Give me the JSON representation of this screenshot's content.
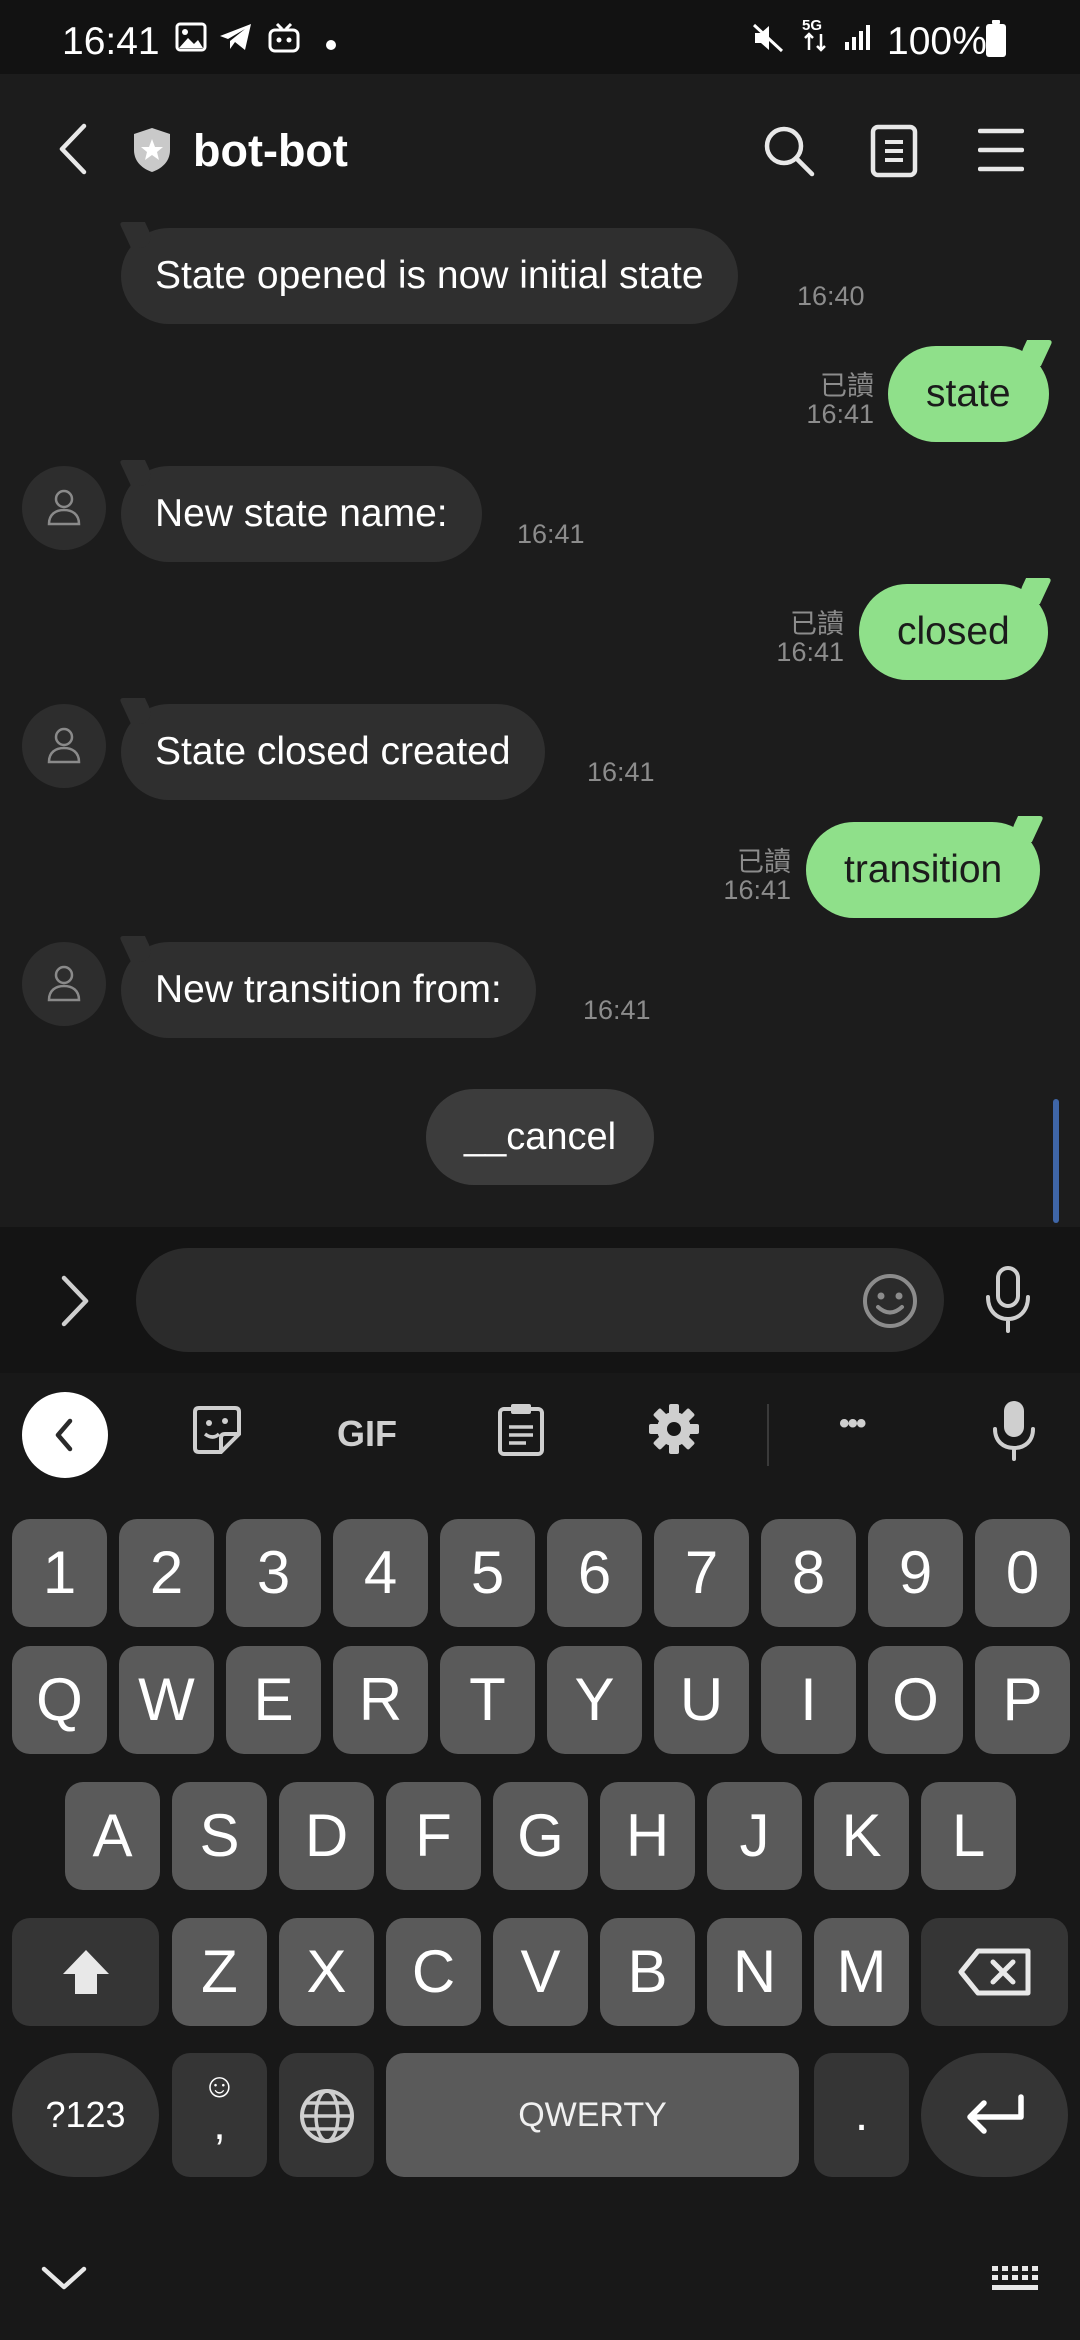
{
  "status_bar": {
    "time": "16:41",
    "battery": "100%",
    "network": "5G",
    "left_icons": [
      "image-icon",
      "telegram-icon",
      "bilibili-icon",
      "dot-icon"
    ],
    "right_icons": [
      "mute-icon",
      "5g-data-icon",
      "signal-icon",
      "battery-icon"
    ]
  },
  "header": {
    "title": "bot-bot",
    "icons": [
      "back-icon",
      "shield-star-icon",
      "search-icon",
      "notes-icon",
      "menu-icon"
    ]
  },
  "messages": [
    {
      "side": "in",
      "text": "State opened is now initial state",
      "time": "16:40",
      "avatar": false
    },
    {
      "side": "out",
      "text": "state",
      "time": "16:41",
      "read": "已讀"
    },
    {
      "side": "in",
      "text": "New state name:",
      "time": "16:41",
      "avatar": true
    },
    {
      "side": "out",
      "text": "closed",
      "time": "16:41",
      "read": "已讀"
    },
    {
      "side": "in",
      "text": "State closed created",
      "time": "16:41",
      "avatar": true
    },
    {
      "side": "out",
      "text": "transition",
      "time": "16:41",
      "read": "已讀"
    },
    {
      "side": "in",
      "text": "New transition from:",
      "time": "16:41",
      "avatar": true
    }
  ],
  "quick_reply": "__cancel",
  "input": {
    "value": "",
    "placeholder": ""
  },
  "keyboard": {
    "toolbar": [
      "collapse-icon",
      "sticker-icon",
      "GIF",
      "clipboard-icon",
      "settings-icon",
      "more-icon",
      "voice-icon"
    ],
    "gif_label": "GIF",
    "more_label": "•••",
    "number_row": [
      "1",
      "2",
      "3",
      "4",
      "5",
      "6",
      "7",
      "8",
      "9",
      "0"
    ],
    "row1": [
      "Q",
      "W",
      "E",
      "R",
      "T",
      "Y",
      "U",
      "I",
      "O",
      "P"
    ],
    "row2": [
      "A",
      "S",
      "D",
      "F",
      "G",
      "H",
      "J",
      "K",
      "L"
    ],
    "row3": [
      "Z",
      "X",
      "C",
      "V",
      "B",
      "N",
      "M"
    ],
    "symbols_label": "?123",
    "comma_label": ",",
    "emoji_label": "☺",
    "space_label": "QWERTY",
    "period_label": "."
  },
  "colors": {
    "outgoing_bubble": "#8fe08a",
    "incoming_bubble": "#2f2f2f",
    "background": "#1c1c1c",
    "key": "#5a5a5a"
  }
}
